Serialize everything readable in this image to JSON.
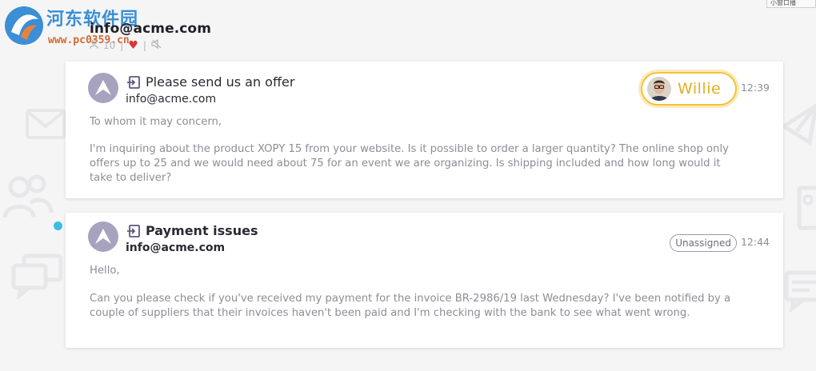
{
  "watermark": {
    "brand": "河东软件园",
    "url": "www.pc0359.cn"
  },
  "corner_fragment": {
    "label": "小窗口播"
  },
  "header": {
    "title": "info@acme.com",
    "count": "10",
    "separator": "|"
  },
  "conversations": [
    {
      "subject": "Please send us an offer",
      "from": "info@acme.com",
      "assignee": "Willie",
      "time": "12:39",
      "greeting": "To whom it may concern,",
      "message": "I'm inquiring about the product XOPY 15 from your website. Is it possible to order a larger quantity? The online shop only offers up to 25 and we would need about 75 for an event we are organizing. Is shipping included and how long would it take to deliver?",
      "unread": false
    },
    {
      "subject": "Payment issues",
      "from": "info@acme.com",
      "status": "Unassigned",
      "time": "12:44",
      "greeting": "Hello,",
      "message": "Can you please check if you've received my payment for the invoice BR-2986/19 last Wednesday? I've been notified by a couple of suppliers that their invoices haven't been paid and I'm checking with the bank to see what went wrong.",
      "unread": true
    }
  ],
  "colors": {
    "background": "#f5f5f6",
    "assignee_accent": "#f2c23c",
    "unread_dot": "#3fbce3",
    "avatar": "#a7a3bf"
  },
  "icons": [
    "inbox-arrow-icon",
    "user-icon",
    "heart-icon",
    "mute-icon",
    "agency-logo-icon"
  ]
}
